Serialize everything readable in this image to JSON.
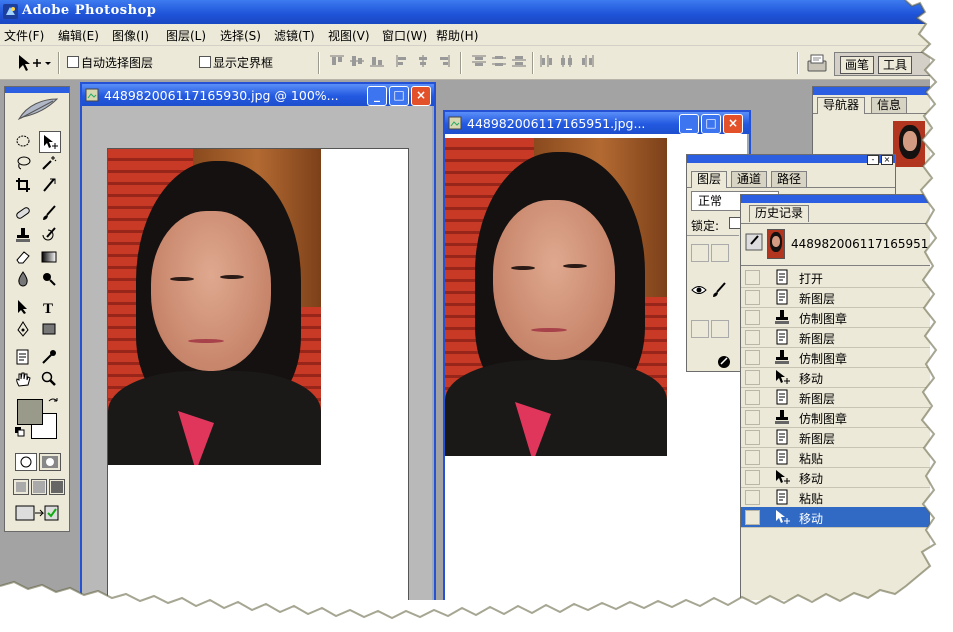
{
  "app": {
    "title": "Adobe Photoshop"
  },
  "menu": [
    "文件(F)",
    "编辑(E)",
    "图像(I)",
    "图层(L)",
    "选择(S)",
    "滤镜(T)",
    "视图(V)",
    "窗口(W)",
    "帮助(H)"
  ],
  "options_bar": {
    "auto_select_layer": "自动选择图层",
    "show_bounding_box": "显示定界框",
    "brush_tab": "画笔",
    "tools_tab": "工具"
  },
  "documents": [
    {
      "title": "448982006117165930.jpg @ 100%..."
    },
    {
      "title": "448982006117165951.jpg..."
    }
  ],
  "navigator": {
    "tabs": [
      "导航器",
      "信息"
    ]
  },
  "layers": {
    "tabs": [
      "图层",
      "通道",
      "路径"
    ],
    "blend_mode": "正常",
    "lock_label": "锁定:"
  },
  "history": {
    "title": "历史记录",
    "snapshot_name": "448982006117165951...",
    "items": [
      {
        "label": "打开",
        "icon": "document-icon"
      },
      {
        "label": "新图层",
        "icon": "document-icon"
      },
      {
        "label": "仿制图章",
        "icon": "stamp-icon"
      },
      {
        "label": "新图层",
        "icon": "document-icon"
      },
      {
        "label": "仿制图章",
        "icon": "stamp-icon"
      },
      {
        "label": "移动",
        "icon": "move-icon"
      },
      {
        "label": "新图层",
        "icon": "document-icon"
      },
      {
        "label": "仿制图章",
        "icon": "stamp-icon"
      },
      {
        "label": "新图层",
        "icon": "document-icon"
      },
      {
        "label": "粘贴",
        "icon": "document-icon"
      },
      {
        "label": "移动",
        "icon": "move-icon"
      },
      {
        "label": "粘贴",
        "icon": "document-icon"
      },
      {
        "label": "移动",
        "icon": "move-icon",
        "selected": true
      }
    ]
  },
  "colors": {
    "xp_blue": "#2552d5",
    "face_bg": "#ece9d8",
    "selection": "#316ac5",
    "foreground_swatch": "#9a9a8a",
    "background_swatch": "#ffffff"
  }
}
